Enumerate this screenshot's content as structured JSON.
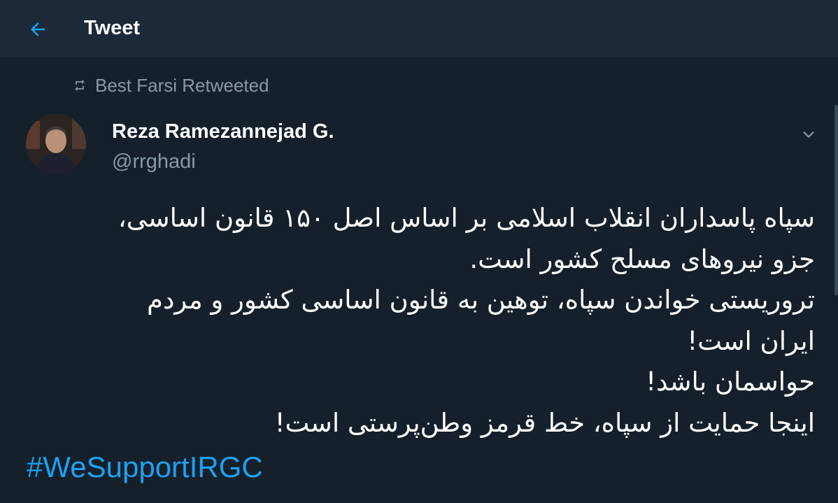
{
  "header": {
    "title": "Tweet",
    "back_icon": "arrow-left-icon"
  },
  "retweet": {
    "icon": "retweet-icon",
    "label": "Best Farsi Retweeted"
  },
  "author": {
    "name": "Reza Ramezannejad G.",
    "handle": "@rrghadi"
  },
  "tweet": {
    "lines": [
      "سپاه پاسداران انقلاب اسلامی بر اساس اصل ۱۵۰ قانون اساسی،",
      "جزو نیروهای مسلح کشور است.",
      "تروریستی خواندن سپاه، توهین به قانون اساسی کشور و مردم",
      "ایران است!",
      "حواسمان باشد!",
      "اینجا حمایت از سپاه، خط قرمز وطن‌پرستی است!"
    ],
    "hashtag": "#WeSupportIRGC"
  },
  "colors": {
    "background": "#15202b",
    "header_background": "#1c2938",
    "accent": "#1da1f2",
    "secondary_text": "#8899a6"
  }
}
